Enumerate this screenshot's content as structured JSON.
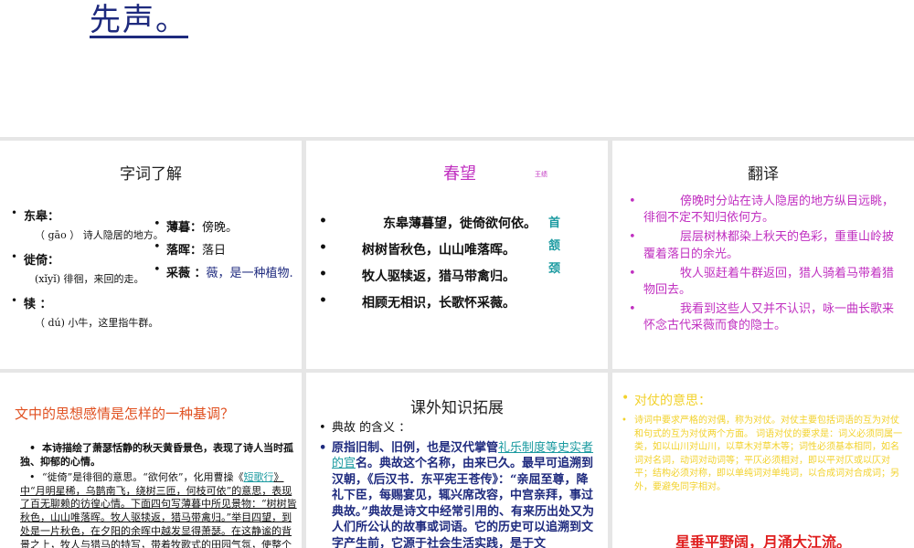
{
  "top": {
    "title": "先声。"
  },
  "slide1": {
    "title": "字词了解",
    "left_items": [
      {
        "term": "东皋：",
        "def": "（ gāo ） 诗人隐居的地方。"
      },
      {
        "term": "徙倚：",
        "def": "(xǐyǐ) 徘徊，来回的走。"
      },
      {
        "term": "犊 ：",
        "def": "（ dú) 小牛，这里指牛群。"
      }
    ],
    "right_items": [
      {
        "term": "薄暮：",
        "def": "傍晚。"
      },
      {
        "term": "落晖：",
        "def": "落日"
      },
      {
        "term": "采薇 ：",
        "def": "薇，是一种植物."
      }
    ]
  },
  "slide2": {
    "title": "春望",
    "author": "王绩",
    "lines": [
      "东皋薄暮望，徙倚欲何依。",
      "树树皆秋色，山山唯落晖。",
      "牧人驱犊返，猎马带禽归。",
      "相顾无相识，长歌怀采薇。"
    ],
    "tags": [
      "首",
      "颔",
      "颈"
    ]
  },
  "slide3": {
    "title": "翻译",
    "lines": [
      "傍晚时分站在诗人隐居的地方纵目远眺，徘徊不定不知归依何方。",
      "层层树林都染上秋天的色彩，重重山岭披覆着落日的余光。",
      "牧人驱赶着牛群返回，猎人骑着马带着猎物回去。",
      "我看到这些人又并不认识，咏一曲长歌来怀念古代采薇而食的隐士。"
    ]
  },
  "slide4": {
    "question": "文中的思想感情是怎样的一种基调？",
    "p1": "本诗描绘了萧瑟恬静的秋天黄昏景色，表现了诗人当时孤独、抑郁的心情。",
    "p2_a": "“徙倚”是徘徊的意思。“欲何依”，化用曹操《",
    "p2_link": "短歌行",
    "p2_b": "》中“月明星稀，乌鹊南飞，绕树三匝，何枝可依”的意思，表现了百无聊赖的彷徨心情。下面四句写薄暮中所见景物：“树树皆秋色，山山唯落晖。牧人驱犊返，猎马带禽归。”举目四望，到处是一片秋色，在夕阳的余晖中越发显得萧瑟。在这静谧的背景之上，牧人与猎马的特写，带着牧歌式的田园气氛，使整个画面"
  },
  "slide5": {
    "title": "课外知识拓展",
    "item1": "典故 的含义 ：",
    "text_a": "原指旧制、旧例，也是汉代掌管",
    "text_link": "礼乐制度等史实者的官",
    "text_b": "名。典故这个名称，由来已久。最早可追溯到汉朝，《后汉书．东平宪王苍传》：“亲屈至尊，降礼下臣，每赐宴见，辄兴席改容，中宫亲拜，事过典故。”典故是诗文中经常引用的、有来历出处又为人们所公认的故事或词语。它的历史可以追溯到文字产生前，它源于社会生活实践，是于文"
  },
  "slide6": {
    "heading": "对仗的意思：",
    "body": "诗词中要求严格的对偶，称为对仗。对仗主要包括词语的互为对仗和句式的互为对仗两个方面。 词语对仗的要求是：词义必须同属一类，如以山川对山川，以草木对草木等；词性必须基本相同，如名词对名词，动词对动词等；平仄必须相对，即以平对仄或以仄对平；结构必须对称，即以单纯词对单纯词，以合成词对合成词；另外，要避免同字相对。",
    "couplet": "星垂平野阔，月涌大江流。"
  }
}
